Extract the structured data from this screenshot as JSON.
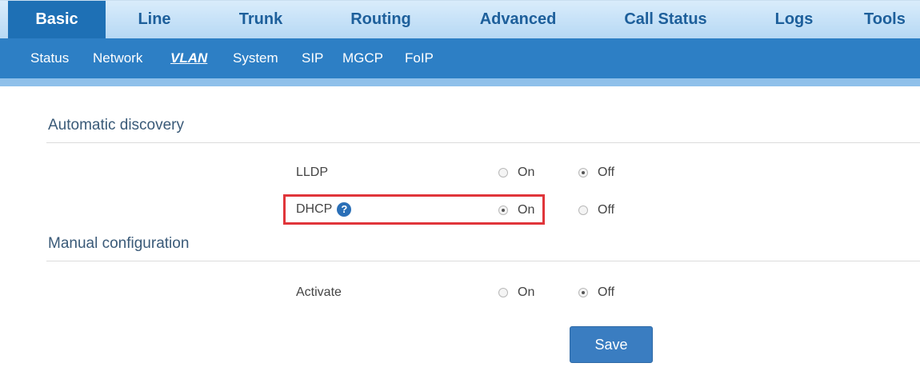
{
  "top_nav": {
    "tabs": [
      {
        "label": "Basic",
        "active": true
      },
      {
        "label": "Line"
      },
      {
        "label": "Trunk"
      },
      {
        "label": "Routing"
      },
      {
        "label": "Advanced"
      },
      {
        "label": "Call Status"
      },
      {
        "label": "Logs"
      },
      {
        "label": "Tools"
      }
    ]
  },
  "sub_nav": {
    "items": [
      {
        "label": "Status"
      },
      {
        "label": "Network"
      },
      {
        "label": "VLAN",
        "active": true
      },
      {
        "label": "System"
      },
      {
        "label": "SIP"
      },
      {
        "label": "MGCP"
      },
      {
        "label": "FoIP"
      }
    ]
  },
  "sections": {
    "auto": {
      "title": "Automatic discovery"
    },
    "manual": {
      "title": "Manual configuration"
    }
  },
  "fields": {
    "lldp": {
      "label": "LLDP",
      "on": "On",
      "off": "Off",
      "value": "Off"
    },
    "dhcp": {
      "label": "DHCP",
      "help_icon": "?",
      "on": "On",
      "off": "Off",
      "value": "On"
    },
    "activate": {
      "label": "Activate",
      "on": "On",
      "off": "Off",
      "value": "Off"
    }
  },
  "actions": {
    "save_label": "Save"
  },
  "colors": {
    "accent": "#1e70b5",
    "highlight": "#e0353a"
  }
}
